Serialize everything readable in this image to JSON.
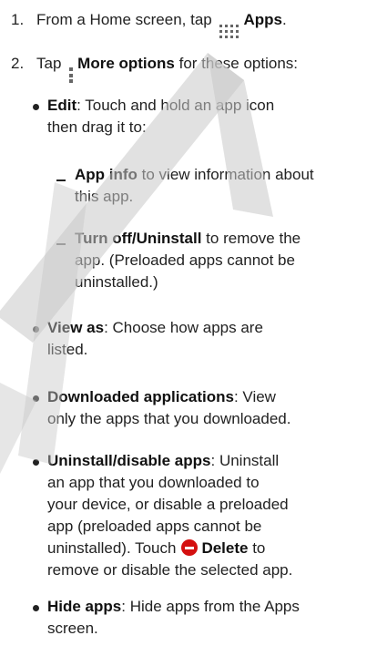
{
  "steps": [
    {
      "num": "1.",
      "text_before": "From a Home screen, tap",
      "icon": "apps-grid-icon",
      "bold": "Apps",
      "text_after": "."
    },
    {
      "num": "2.",
      "text_before": "Tap",
      "icon": "more-options-icon",
      "bold": "More options",
      "text_after": " for these options:"
    }
  ],
  "edit": {
    "bold": "Edit",
    "line1": ": Touch and hold an app icon",
    "line2": "then drag it to:",
    "subs": [
      {
        "bold": "App info",
        "line1": " to view information about",
        "line2": "this app."
      },
      {
        "bold": "Turn off/Uninstall",
        "line1": " to remove the",
        "line2": "app. (Preloaded apps cannot be",
        "line3": "uninstalled.)"
      }
    ]
  },
  "view_as": {
    "bold": "View as",
    "line1": ": Choose how apps are",
    "line2": "listed."
  },
  "downloaded": {
    "bold": "Downloaded applications",
    "line1": ": View",
    "line2": "only the apps that you downloaded."
  },
  "uninstall": {
    "bold": "Uninstall/disable apps",
    "line1": ": Uninstall",
    "line2": "an app that you downloaded to",
    "line3": "your device, or disable a preloaded",
    "line4": "app (preloaded apps cannot be",
    "line5_before": "uninstalled). Touch",
    "icon": "delete-icon",
    "line5_bold": "Delete",
    "line5_after": " to",
    "line6": "remove or disable the selected app."
  },
  "hide": {
    "bold": "Hide apps",
    "line1": ": Hide apps from the Apps",
    "line2": "screen."
  },
  "colors": {
    "text": "#222222",
    "watermark": "#c8c8c8",
    "delete_icon": "#d41010"
  }
}
